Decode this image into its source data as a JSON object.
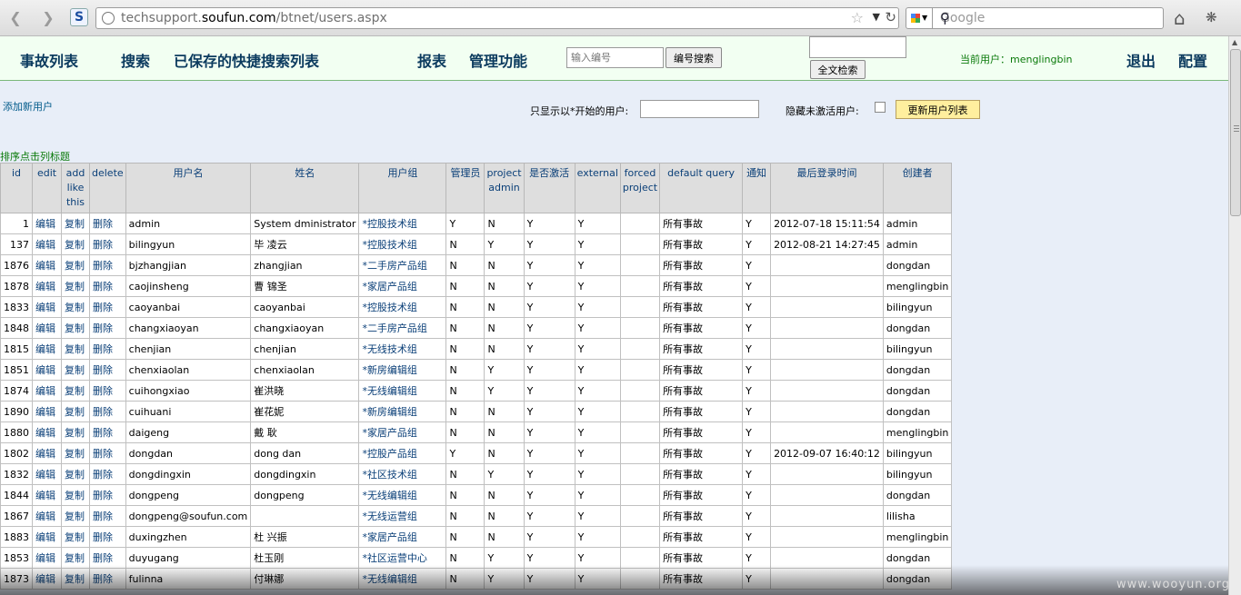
{
  "browser": {
    "url_prefix": "techsupport.",
    "url_domain": "soufun.com",
    "url_path": "/btnet/users.aspx",
    "search_placeholder": "Google"
  },
  "nav": {
    "items": [
      "事故列表",
      "搜索",
      "已保存的快捷搜索列表",
      "报表",
      "管理功能"
    ],
    "id_placeholder": "输入编号",
    "id_button": "编号搜索",
    "fulltext_button": "全文检索",
    "current_user_label": "当前用户：",
    "current_user": "menglingbin",
    "logout": "退出",
    "config": "配置"
  },
  "toolbar": {
    "add_user": "添加新用户",
    "filter_label": "只显示以*开始的用户:",
    "hide_label": "隐藏未激活用户:",
    "update_button": "更新用户列表",
    "sort_hint": "排序点击列标题"
  },
  "table": {
    "headers": [
      "id",
      "edit",
      "add like this",
      "delete",
      "用户名",
      "姓名",
      "用户组",
      "管理员",
      "project admin",
      "是否激活",
      "external",
      "forced project",
      "default query",
      "通知",
      "最后登录时间",
      "创建者"
    ],
    "action_labels": [
      "编辑",
      "复制",
      "删除"
    ],
    "rows": [
      [
        "1",
        "admin",
        "System dministrator",
        "*控股技术组",
        "Y",
        "N",
        "Y",
        "Y",
        "所有事故",
        "Y",
        "2012-07-18 15:11:54",
        "admin"
      ],
      [
        "137",
        "bilingyun",
        "毕 凌云",
        "*控股技术组",
        "N",
        "Y",
        "Y",
        "Y",
        "所有事故",
        "Y",
        "2012-08-21 14:27:45",
        "admin"
      ],
      [
        "1876",
        "bjzhangjian",
        "zhangjian",
        "*二手房产品组",
        "N",
        "N",
        "Y",
        "Y",
        "所有事故",
        "Y",
        "",
        "dongdan"
      ],
      [
        "1878",
        "caojinsheng",
        "曹 锦圣",
        "*家居产品组",
        "N",
        "N",
        "Y",
        "Y",
        "所有事故",
        "Y",
        "",
        "menglingbin"
      ],
      [
        "1833",
        "caoyanbai",
        "caoyanbai",
        "*控股技术组",
        "N",
        "N",
        "Y",
        "Y",
        "所有事故",
        "Y",
        "",
        "bilingyun"
      ],
      [
        "1848",
        "changxiaoyan",
        "changxiaoyan",
        "*二手房产品组",
        "N",
        "N",
        "Y",
        "Y",
        "所有事故",
        "Y",
        "",
        "dongdan"
      ],
      [
        "1815",
        "chenjian",
        "chenjian",
        "*无线技术组",
        "N",
        "N",
        "Y",
        "Y",
        "所有事故",
        "Y",
        "",
        "bilingyun"
      ],
      [
        "1851",
        "chenxiaolan",
        "chenxiaolan",
        "*新房编辑组",
        "N",
        "Y",
        "Y",
        "Y",
        "所有事故",
        "Y",
        "",
        "dongdan"
      ],
      [
        "1874",
        "cuihongxiao",
        "崔洪晓",
        "*无线编辑组",
        "N",
        "Y",
        "Y",
        "Y",
        "所有事故",
        "Y",
        "",
        "dongdan"
      ],
      [
        "1890",
        "cuihuani",
        "崔花妮",
        "*新房编辑组",
        "N",
        "N",
        "Y",
        "Y",
        "所有事故",
        "Y",
        "",
        "dongdan"
      ],
      [
        "1880",
        "daigeng",
        "戴 耿",
        "*家居产品组",
        "N",
        "N",
        "Y",
        "Y",
        "所有事故",
        "Y",
        "",
        "menglingbin"
      ],
      [
        "1802",
        "dongdan",
        "dong dan",
        "*控股产品组",
        "Y",
        "N",
        "Y",
        "Y",
        "所有事故",
        "Y",
        "2012-09-07 16:40:12",
        "bilingyun"
      ],
      [
        "1832",
        "dongdingxin",
        "dongdingxin",
        "*社区技术组",
        "N",
        "Y",
        "Y",
        "Y",
        "所有事故",
        "Y",
        "",
        "bilingyun"
      ],
      [
        "1844",
        "dongpeng",
        "dongpeng",
        "*无线编辑组",
        "N",
        "N",
        "Y",
        "Y",
        "所有事故",
        "Y",
        "",
        "dongdan"
      ],
      [
        "1867",
        "dongpeng@soufun.com",
        "",
        "*无线运营组",
        "N",
        "N",
        "Y",
        "Y",
        "所有事故",
        "Y",
        "",
        "lilisha"
      ],
      [
        "1883",
        "duxingzhen",
        "杜 兴振",
        "*家居产品组",
        "N",
        "N",
        "Y",
        "Y",
        "所有事故",
        "Y",
        "",
        "menglingbin"
      ],
      [
        "1853",
        "duyugang",
        "杜玉刚",
        "*社区运营中心",
        "N",
        "Y",
        "Y",
        "Y",
        "所有事故",
        "Y",
        "",
        "dongdan"
      ],
      [
        "1873",
        "fulinna",
        "付琳娜",
        "*无线编辑组",
        "N",
        "Y",
        "Y",
        "Y",
        "所有事故",
        "Y",
        "",
        "dongdan"
      ]
    ]
  },
  "watermark": "www.wooyun.org"
}
